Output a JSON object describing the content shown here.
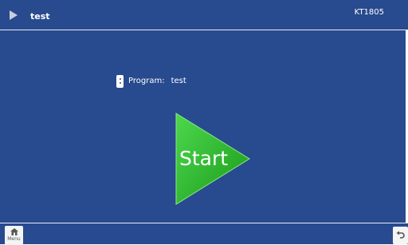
{
  "header": {
    "title": "test",
    "device_id": "KT1805"
  },
  "program": {
    "label": "Program:",
    "value": "test"
  },
  "start": {
    "label": "Start"
  },
  "footer": {
    "menu_label": "Menu",
    "menu_icon": "home-icon",
    "back_icon": "undo-icon"
  },
  "colors": {
    "background": "#284a8e",
    "start_button": "#2fbf2f"
  }
}
